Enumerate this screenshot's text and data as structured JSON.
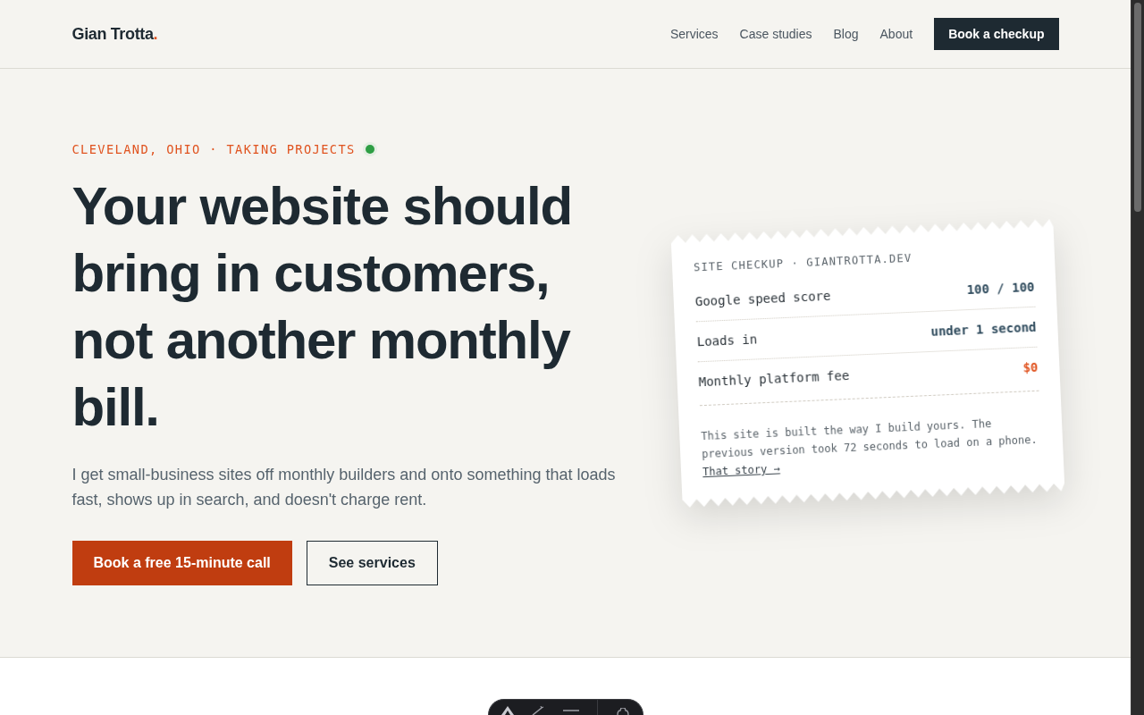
{
  "header": {
    "logo": {
      "text": "Gian Trotta",
      "dot": "."
    },
    "nav": [
      "Services",
      "Case studies",
      "Blog",
      "About"
    ],
    "cta": "Book a checkup"
  },
  "hero": {
    "eyebrow": {
      "text": "CLEVELAND, OHIO · TAKING PROJECTS",
      "available": true
    },
    "heading": "Your website should bring in customers, not another monthly bill.",
    "lead": "I get small-business sites off monthly builders and onto something that loads fast, shows up in search, and doesn't charge rent.",
    "buttons": [
      {
        "label": "Book a free 15-minute call",
        "kind": "primary"
      },
      {
        "label": "See services",
        "kind": "secondary"
      }
    ]
  },
  "checkup_card": {
    "title": "SITE CHECKUP · GIANTROTTA.DEV",
    "rows": [
      {
        "label": "Google speed score",
        "value": "100 / 100",
        "highlighted": false
      },
      {
        "label": "Loads in",
        "value": "under 1 second",
        "highlighted": false
      },
      {
        "label": "Monthly platform fee",
        "value": "$0",
        "highlighted": true
      }
    ],
    "note": "This site is built the way I build yours. The previous version took 72 seconds to load on a phone.",
    "link": "That story →"
  }
}
